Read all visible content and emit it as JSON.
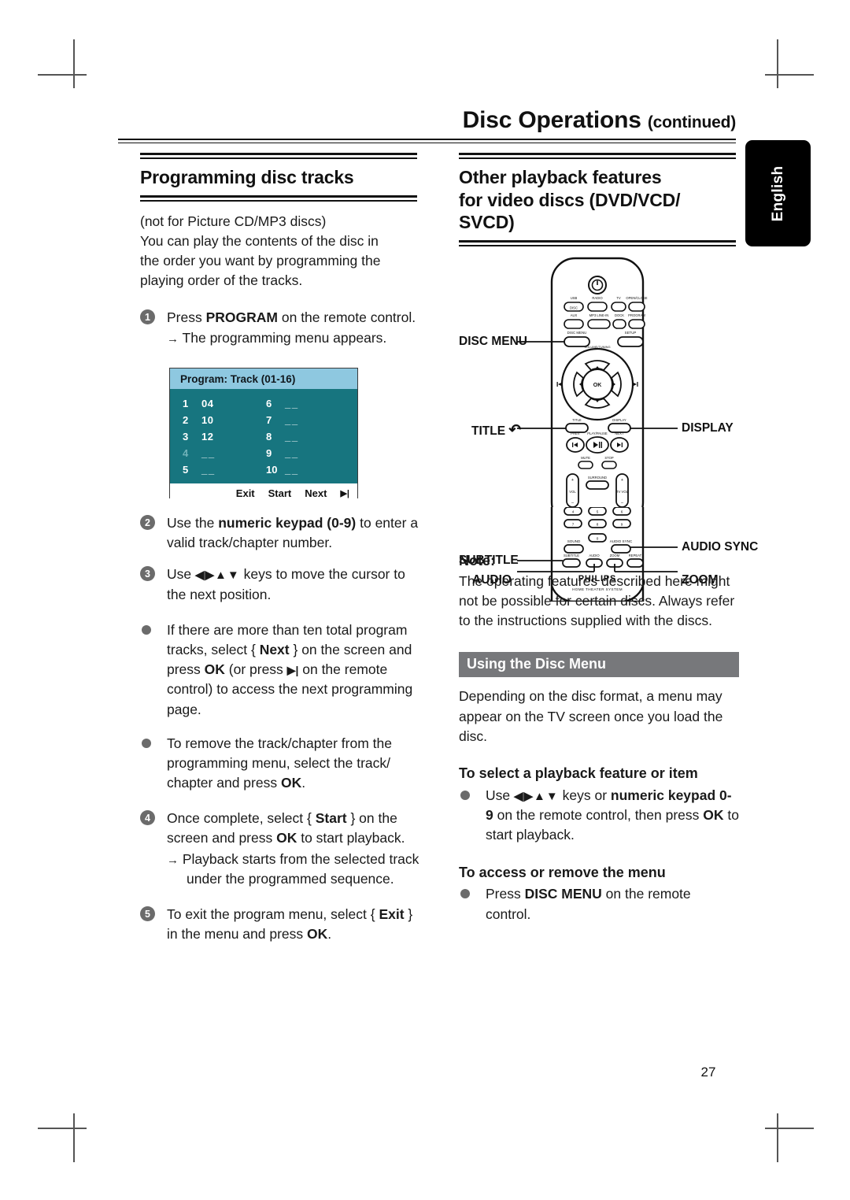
{
  "header": {
    "title": "Disc Operations",
    "continued": "(continued)"
  },
  "language_tab": {
    "label": "English"
  },
  "page_number": "27",
  "left_column": {
    "heading": "Programming disc tracks",
    "intro": [
      "(not for Picture CD/MP3 discs)",
      "You can play the contents of the disc in",
      "the order you want by programming the",
      "playing order of the tracks."
    ],
    "step1": {
      "num": "1",
      "text_pre": "Press ",
      "text_bold": "PROGRAM",
      "text_post": " on the remote control.",
      "result_arrow": "→",
      "result": "The programming menu appears."
    },
    "step2": {
      "num": "2",
      "text_pre": "Use the ",
      "text_bold": "numeric keypad (0-9)",
      "text_post": " to enter a valid track/chapter number."
    },
    "step3": {
      "num": "3",
      "text_pre": "Use ",
      "keys": "◀▶▲▼",
      "text_post": " keys to move the cursor to the next position."
    },
    "bullet1": {
      "p1": "If there are more than ten total program tracks, select { ",
      "b1": "Next",
      "p2": " } on the screen and press ",
      "b2": "OK",
      "p3": " (or press ",
      "glyph": "▶|",
      "p4": " on the remote control) to access the next programming page."
    },
    "bullet2": {
      "p1": "To remove the track/chapter from the programming menu, select the track/ chapter and press ",
      "b1": "OK",
      "p2": "."
    },
    "step4": {
      "num": "4",
      "p1": "Once complete, select { ",
      "b1": "Start",
      "p2": " } on the screen and press ",
      "b2": "OK",
      "p3": " to start playback.",
      "result_arrow": "→",
      "result": "Playback starts from the selected track under the programmed sequence."
    },
    "step5": {
      "num": "5",
      "p1": "To exit the program menu, select { ",
      "b1": "Exit",
      "p2": " } in the menu and press ",
      "b2": "OK",
      "p3": "."
    }
  },
  "program_menu": {
    "title": "Program: Track (01-16)",
    "colors": {
      "header_bg": "#8ec8e0",
      "body_bg": "#17757f",
      "text": "#ffffff"
    },
    "entries_left": [
      {
        "index": "1",
        "value": "04",
        "cursor": false
      },
      {
        "index": "2",
        "value": "10",
        "cursor": false
      },
      {
        "index": "3",
        "value": "12",
        "cursor": false
      },
      {
        "index": "4",
        "value": "_ _",
        "cursor": true
      },
      {
        "index": "5",
        "value": "_ _",
        "cursor": false
      }
    ],
    "entries_right": [
      {
        "index": "6",
        "value": "_ _",
        "cursor": false
      },
      {
        "index": "7",
        "value": "_ _",
        "cursor": false
      },
      {
        "index": "8",
        "value": "_ _",
        "cursor": false
      },
      {
        "index": "9",
        "value": "_ _",
        "cursor": false
      },
      {
        "index": "10",
        "value": "_ _",
        "cursor": false
      }
    ],
    "footer": {
      "exit": "Exit",
      "start": "Start",
      "next": "Next",
      "next_glyph": "▶|"
    }
  },
  "right_column": {
    "heading_line1": "Other playback features",
    "heading_line2": "for video discs (DVD/VCD/",
    "heading_line3": "SVCD)",
    "note": {
      "label": "Note:",
      "body": "The operating features described here might not be possible for certain discs. Always refer to the instructions supplied with the discs."
    },
    "disc_menu_section": {
      "bar_title": "Using the Disc Menu",
      "body": "Depending on the disc format, a menu may appear on the TV screen once you load the disc.",
      "sub1": {
        "heading": "To select a playback feature or item",
        "p1": "Use ",
        "keys": "◀▶▲▼",
        "p2": " keys or ",
        "b1": "numeric keypad 0-9",
        "p3": " on the remote control, then press ",
        "b2": "OK",
        "p4": " to start playback."
      },
      "sub2": {
        "heading": "To access or remove the menu",
        "p1": "Press ",
        "b1": "DISC MENU",
        "p2": " on the remote control."
      }
    }
  },
  "remote_figure": {
    "brand": "PHILIPS",
    "brand_sub": "HOME THEATER SYSTEM",
    "callouts": {
      "disc_menu": "DISC MENU",
      "title": "TITLE",
      "title_glyph": "↶",
      "display": "DISPLAY",
      "subtitle": "SUBTITLE",
      "audio": "AUDIO",
      "audio_sync": "AUDIO SYNC",
      "zoom": "ZOOM"
    },
    "button_labels": {
      "usb_disc": "USB\nDISC",
      "radio": "RADIO",
      "tv": "TV",
      "open_close": "OPEN/CLOSE",
      "aux": "AUX",
      "mp3_line_in": "MP3 LINE-IN",
      "dock": "DOCK",
      "program": "PROGRAM",
      "disc_menu": "DISC MENU",
      "setup": "SETUP",
      "ok": "OK",
      "prev": "PREV",
      "play_pause": "PLAY/PAUSE",
      "next": "NEXT",
      "mute": "MUTE",
      "stop": "STOP",
      "vol": "VOL",
      "surround": "SURROUND",
      "sound": "SOUND",
      "subtitle": "SUBTITLE",
      "audio": "AUDIO",
      "zoom": "ZOOM",
      "repeat": "REPEAT",
      "audio_sync": "AUDIO SYNC"
    }
  }
}
